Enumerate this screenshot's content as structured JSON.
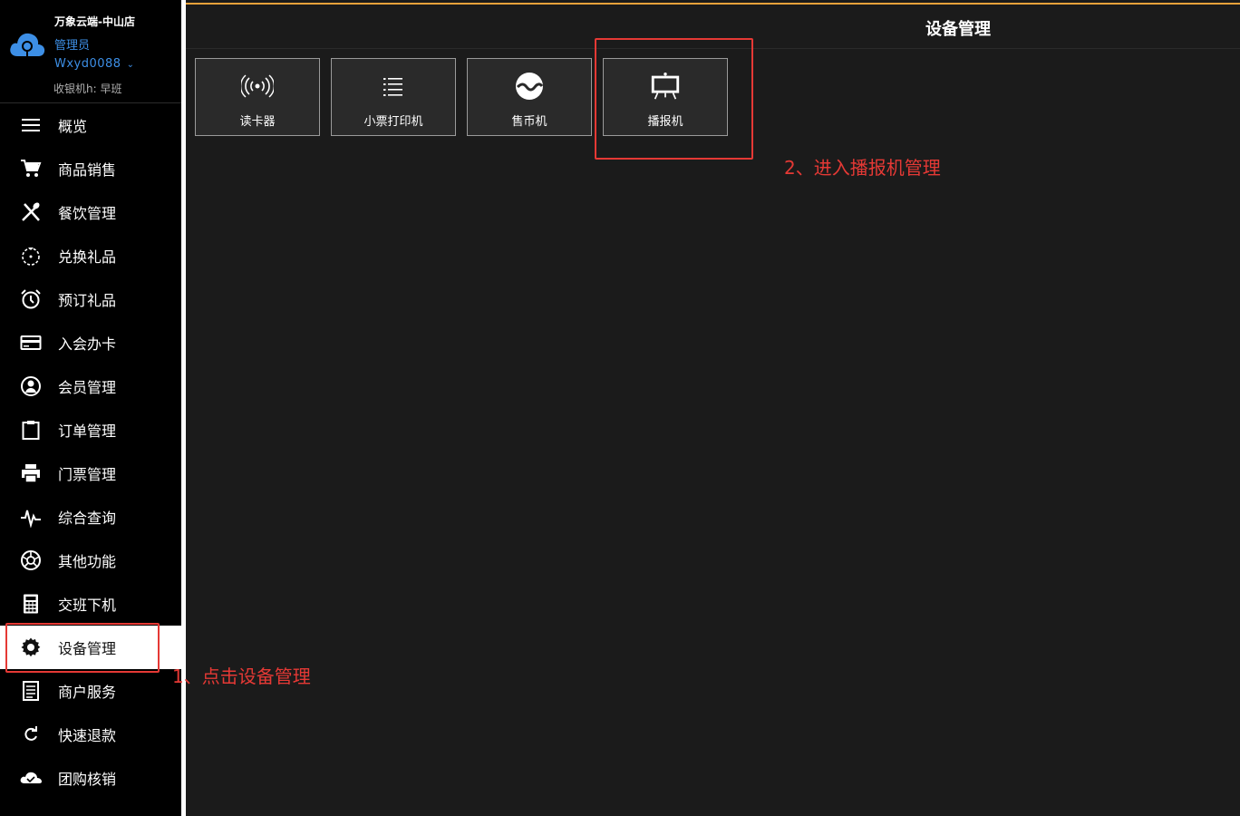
{
  "brand": {
    "store_name": "万象云端-中山店",
    "role": "管理员",
    "username": "Wxyd0088",
    "shift": "收银机h: 早班",
    "logo_color": "#3d8fe6"
  },
  "nav": {
    "items": [
      {
        "label": "概览",
        "icon": "menu-icon"
      },
      {
        "label": "商品销售",
        "icon": "cart-icon"
      },
      {
        "label": "餐饮管理",
        "icon": "utensils-icon"
      },
      {
        "label": "兑换礼品",
        "icon": "gift-exchange-icon"
      },
      {
        "label": "预订礼品",
        "icon": "alarm-clock-icon"
      },
      {
        "label": "入会办卡",
        "icon": "card-icon"
      },
      {
        "label": "会员管理",
        "icon": "user-circle-icon"
      },
      {
        "label": "订单管理",
        "icon": "clipboard-icon"
      },
      {
        "label": "门票管理",
        "icon": "printer-icon"
      },
      {
        "label": "综合查询",
        "icon": "pulse-icon"
      },
      {
        "label": "其他功能",
        "icon": "aperture-icon"
      },
      {
        "label": "交班下机",
        "icon": "calculator-icon"
      },
      {
        "label": "设备管理",
        "icon": "gear-icon"
      },
      {
        "label": "商户服务",
        "icon": "document-icon"
      },
      {
        "label": "快速退款",
        "icon": "refresh-icon"
      },
      {
        "label": "团购核销",
        "icon": "cloud-icon"
      }
    ],
    "active_index": 12
  },
  "main": {
    "title": "设备管理",
    "devices": [
      {
        "label": "读卡器",
        "icon": "wireless-signal-icon"
      },
      {
        "label": "小票打印机",
        "icon": "list-icon"
      },
      {
        "label": "售币机",
        "icon": "coin-wave-icon"
      },
      {
        "label": "播报机",
        "icon": "monitor-easel-icon"
      }
    ]
  },
  "annotations": {
    "step1": "1、点击设备管理",
    "step2": "2、进入播报机管理",
    "color": "#e53935"
  },
  "colors": {
    "accent_line": "#e8a23a",
    "sidebar_bg": "#000000",
    "main_bg": "#1b1b1b",
    "card_bg": "#2a2a2a"
  }
}
